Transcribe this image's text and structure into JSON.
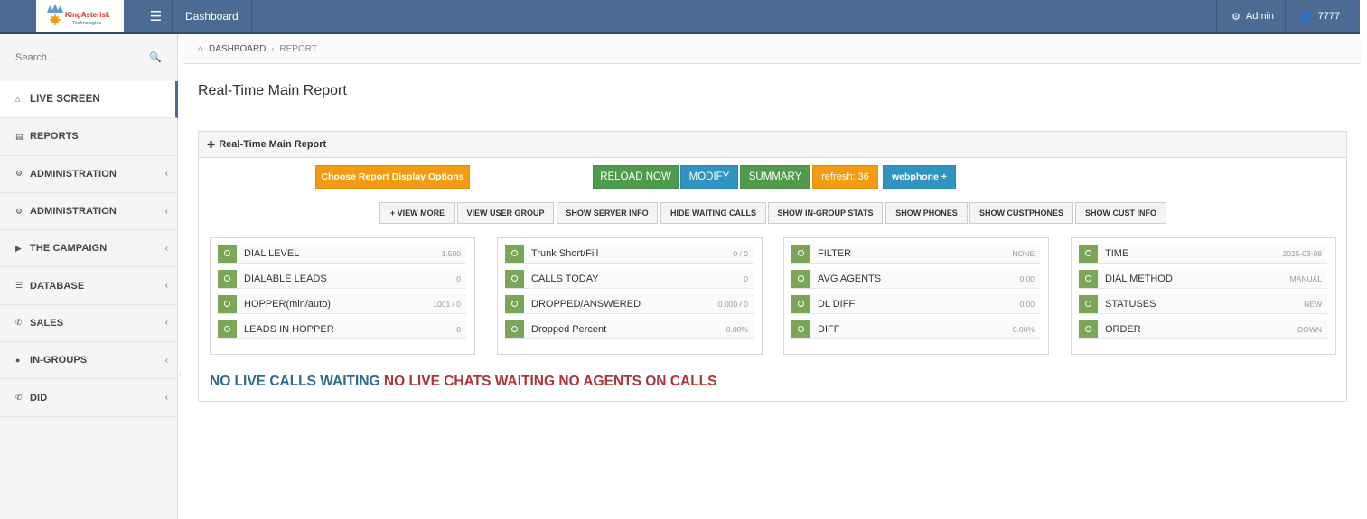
{
  "topbar": {
    "logo_text": "KingAsterisk",
    "logo_sub": "Technologies",
    "nav_label": "Dashboard",
    "admin_label": "Admin",
    "user_label": "7777"
  },
  "sidebar": {
    "search_placeholder": "Search...",
    "items": [
      {
        "label": "LIVE SCREEN",
        "icon": "home-icon"
      },
      {
        "label": "REPORTS",
        "icon": "chart-icon"
      },
      {
        "label": "ADMINISTRATION",
        "icon": "gear-icon"
      },
      {
        "label": "ADMINISTRATION",
        "icon": "gear-icon"
      },
      {
        "label": "THE CAMPAIGN",
        "icon": "bullhorn-icon"
      },
      {
        "label": "DATABASE",
        "icon": "database-icon"
      },
      {
        "label": "SALES",
        "icon": "phone-icon"
      },
      {
        "label": "IN-GROUPS",
        "icon": "user-icon"
      },
      {
        "label": "DID",
        "icon": "phone-icon"
      }
    ]
  },
  "breadcrumb": {
    "home": "DASHBOARD",
    "current": "REPORT"
  },
  "page_title": "Real-Time Main Report",
  "panel": {
    "title": "Real-Time Main Report",
    "choose_options": "Choose Report Display Options",
    "reload": "RELOAD NOW",
    "modify": "MODIFY",
    "summary": "SUMMARY",
    "refresh": "refresh: 36",
    "webphone": "webphone +",
    "toggles": [
      "+ VIEW MORE",
      "VIEW USER GROUP",
      "SHOW SERVER INFO",
      "HIDE WAITING CALLS",
      "SHOW IN-GROUP STATS",
      "SHOW PHONES",
      "SHOW CUSTPHONES",
      "SHOW CUST INFO"
    ]
  },
  "cards": [
    {
      "rows": [
        {
          "label": "DIAL LEVEL",
          "value": "1.500"
        },
        {
          "label": "DIALABLE LEADS",
          "value": "0"
        },
        {
          "label": "HOPPER(min/auto)",
          "value": "1001 / 0"
        },
        {
          "label": "LEADS IN HOPPER",
          "value": "0"
        }
      ]
    },
    {
      "rows": [
        {
          "label": "Trunk Short/Fill",
          "value": "0 / 0"
        },
        {
          "label": "CALLS TODAY",
          "value": "0"
        },
        {
          "label": "DROPPED/ANSWERED",
          "value": "0.000 / 0"
        },
        {
          "label": "Dropped Percent",
          "value": "0.00%"
        }
      ]
    },
    {
      "rows": [
        {
          "label": "FILTER",
          "value": "NONE"
        },
        {
          "label": "AVG AGENTS",
          "value": "0.00"
        },
        {
          "label": "DL DIFF",
          "value": "0.00"
        },
        {
          "label": "DIFF",
          "value": "0.00%"
        }
      ]
    },
    {
      "rows": [
        {
          "label": "TIME",
          "value": "2025-03-08"
        },
        {
          "label": "DIAL METHOD",
          "value": "MANUAL"
        },
        {
          "label": "STATUSES",
          "value": "NEW"
        },
        {
          "label": "ORDER",
          "value": "DOWN"
        }
      ]
    }
  ],
  "status": {
    "calls": "NO LIVE CALLS WAITING",
    "chats": "NO LIVE CHATS WAITING",
    "agents": "NO AGENTS ON CALLS"
  },
  "colors": {
    "topbar": "#4b6b92",
    "green": "#4f9a4c",
    "orange": "#f39c12",
    "blue": "#2f95c0",
    "status_blue": "#2b6b8a",
    "status_red": "#a8363a"
  }
}
